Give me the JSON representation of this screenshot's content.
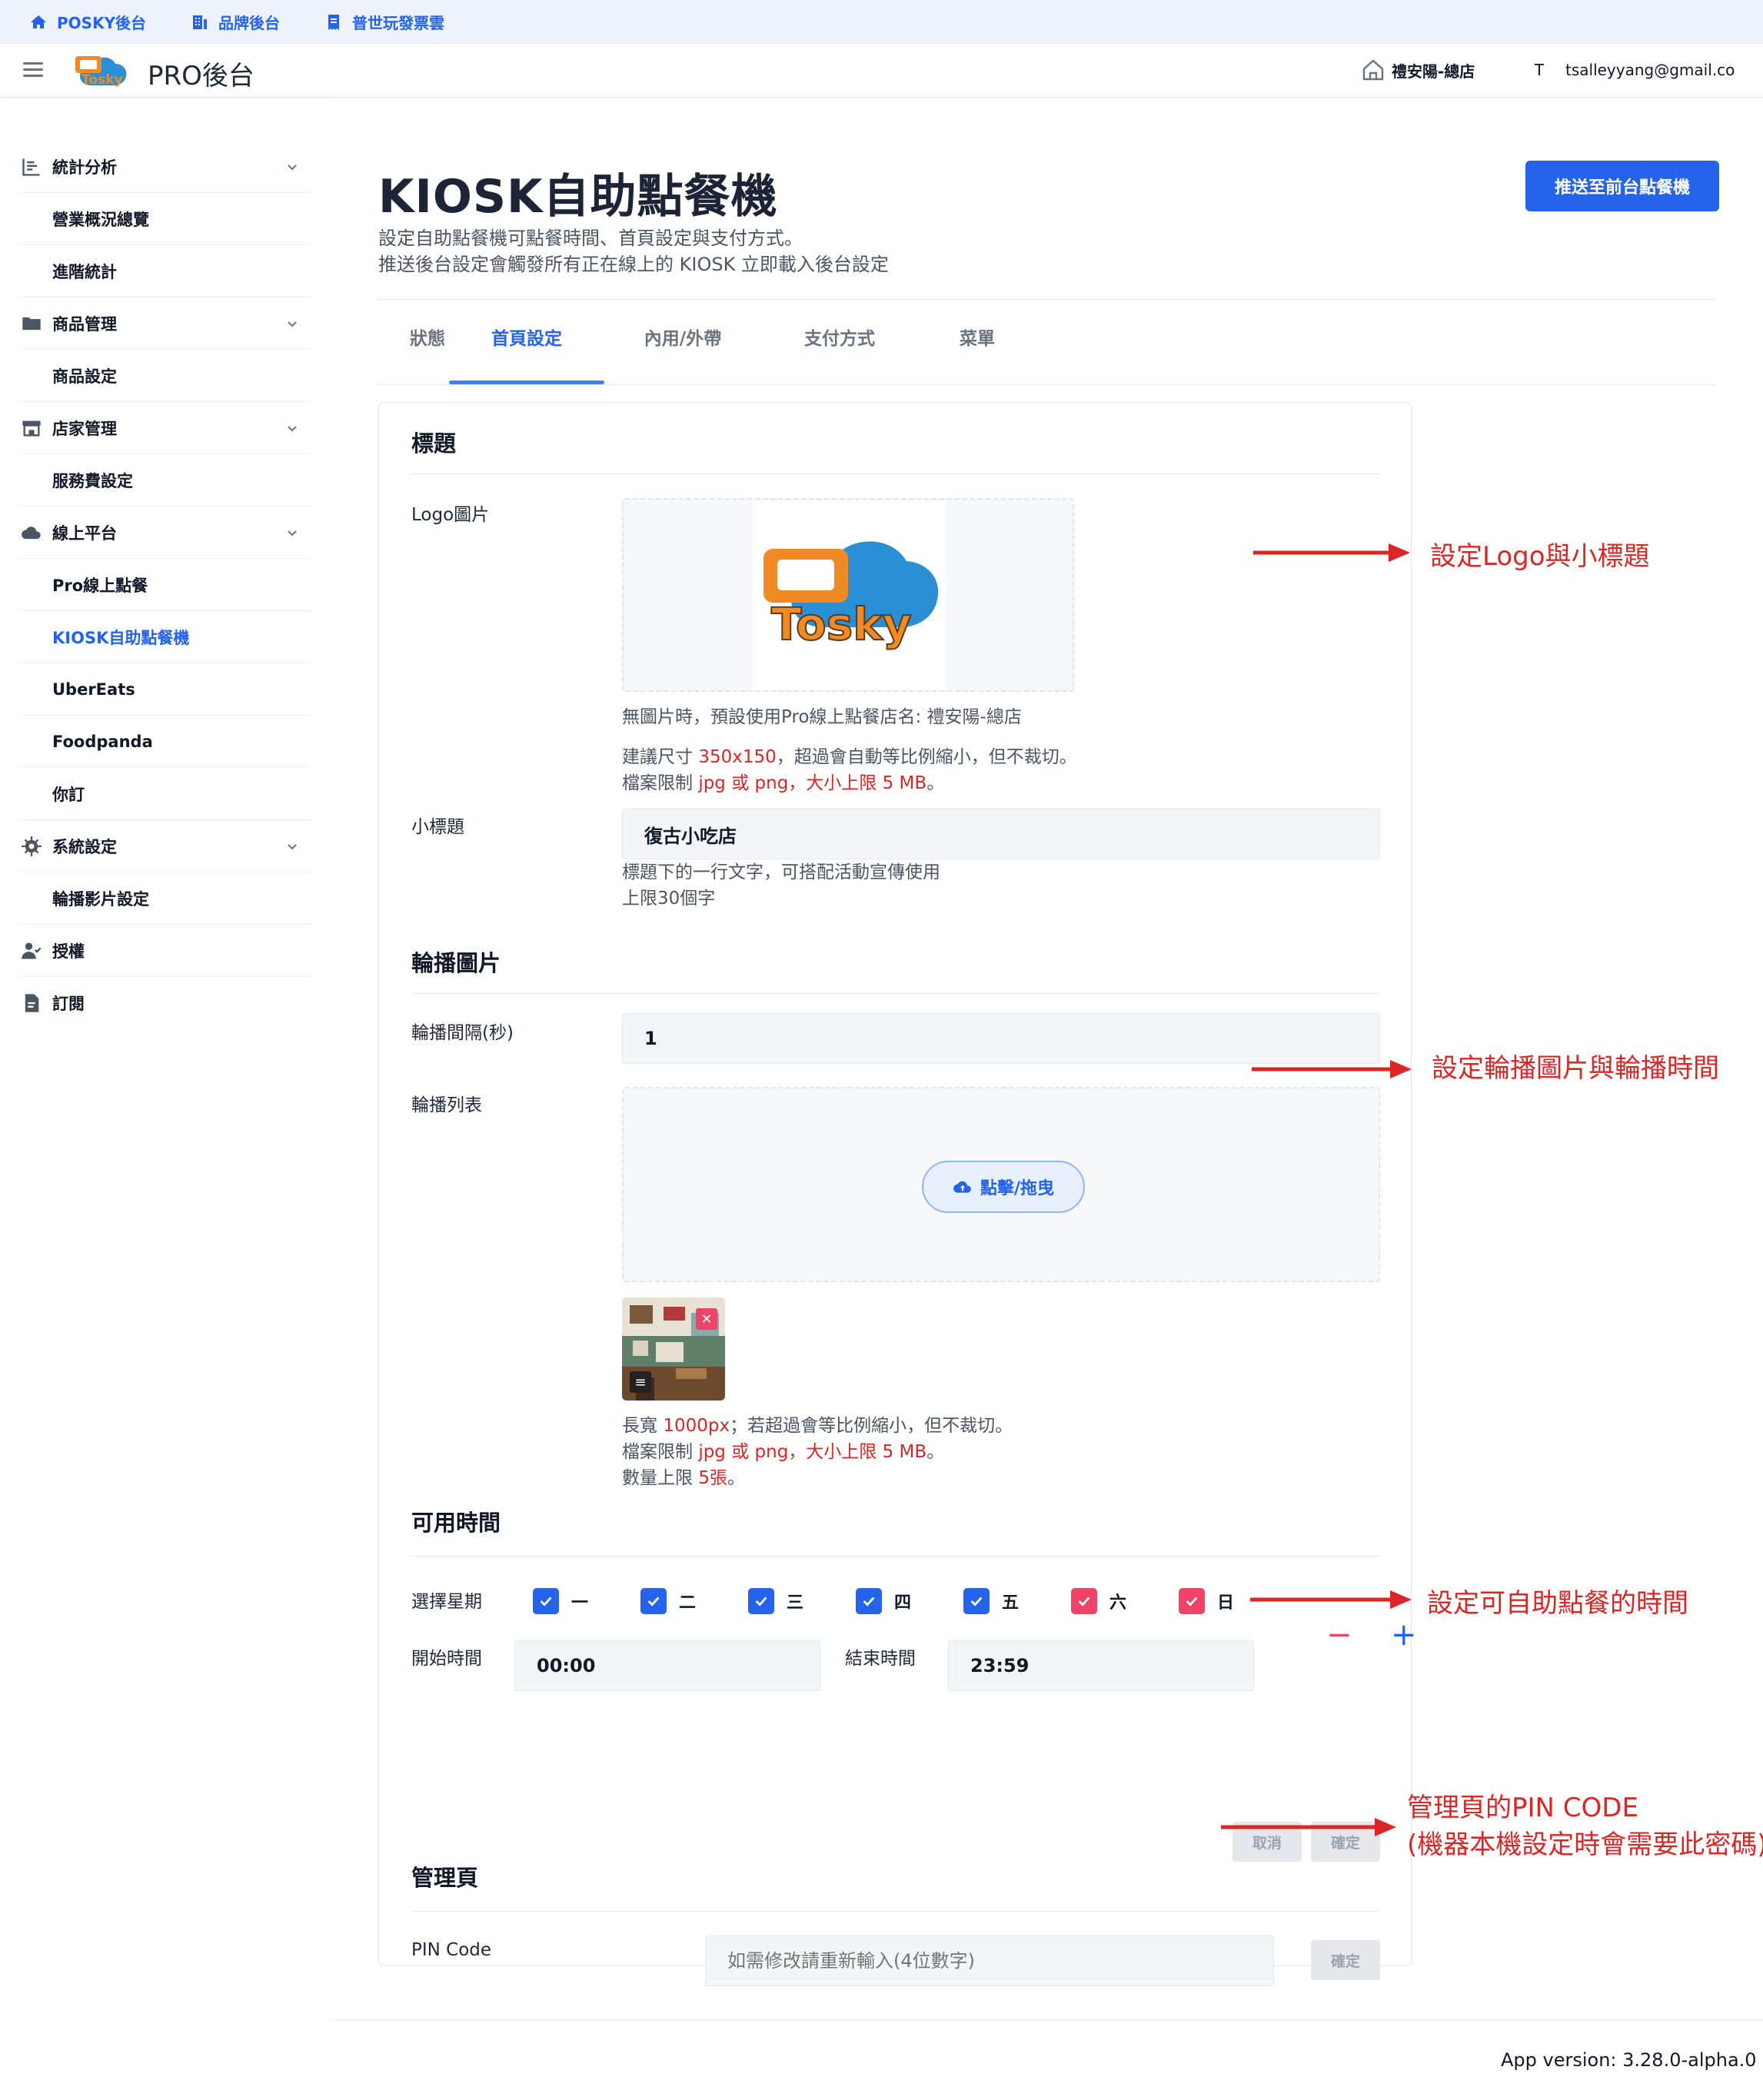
{
  "topbar": {
    "links": [
      {
        "label": "POSKY後台",
        "icon": "home-icon"
      },
      {
        "label": "品牌後台",
        "icon": "building-icon"
      },
      {
        "label": "普世玩發票雲",
        "icon": "receipt-icon"
      }
    ]
  },
  "header": {
    "title": "PRO後台",
    "store": "禮安陽-總店",
    "avatar_initial": "T",
    "email": "tsalleyyang@gmail.co"
  },
  "sidebar": {
    "items": [
      {
        "label": "統計分析",
        "icon": "chart-icon",
        "type": "group"
      },
      {
        "label": "營業概況總覽",
        "type": "sub"
      },
      {
        "label": "進階統計",
        "type": "sub"
      },
      {
        "label": "商品管理",
        "icon": "folder-icon",
        "type": "group"
      },
      {
        "label": "商品設定",
        "type": "sub"
      },
      {
        "label": "店家管理",
        "icon": "store-icon",
        "type": "group"
      },
      {
        "label": "服務費設定",
        "type": "sub"
      },
      {
        "label": "線上平台",
        "icon": "cloud-icon",
        "type": "group"
      },
      {
        "label": "Pro線上點餐",
        "type": "sub"
      },
      {
        "label": "KIOSK自助點餐機",
        "type": "sub",
        "active": true
      },
      {
        "label": "UberEats",
        "type": "sub"
      },
      {
        "label": "Foodpanda",
        "type": "sub"
      },
      {
        "label": "你訂",
        "type": "sub"
      },
      {
        "label": "系統設定",
        "icon": "gear-icon",
        "type": "group"
      },
      {
        "label": "輪播影片設定",
        "type": "sub"
      },
      {
        "label": "授權",
        "icon": "user-check-icon",
        "type": "single"
      },
      {
        "label": "訂閱",
        "icon": "document-icon",
        "type": "single"
      }
    ]
  },
  "page": {
    "title": "KIOSK自助點餐機",
    "desc_line1": "設定自助點餐機可點餐時間、首頁設定與支付方式。",
    "desc_line2": "推送後台設定會觸發所有正在線上的 KIOSK 立即載入後台設定",
    "push_button": "推送至前台點餐機"
  },
  "tabs": [
    "狀態",
    "首頁設定",
    "內用/外帶",
    "支付方式",
    "菜單"
  ],
  "active_tab": "首頁設定",
  "form": {
    "title_section": "標題",
    "logo_label": "Logo圖片",
    "logo_hint1": "無圖片時，預設使用Pro線上點餐店名: 禮安陽-總店",
    "logo_hint2_a": "建議尺寸 ",
    "logo_hint2_b": "350x150",
    "logo_hint2_c": "，超過會自動等比例縮小，但不裁切。",
    "logo_hint3_a": "檔案限制 ",
    "logo_hint3_b": "jpg 或 png，大小上限 5 MB",
    "logo_hint3_c": "。",
    "subtitle_label": "小標題",
    "subtitle_value": "復古小吃店",
    "subtitle_hint1": "標題下的一行文字，可搭配活動宣傳使用",
    "subtitle_hint2": "上限30個字",
    "carousel_section": "輪播圖片",
    "interval_label": "輪播間隔(秒)",
    "interval_value": "1",
    "list_label": "輪播列表",
    "upload_label": "點擊/拖曳",
    "carousel_hint1_a": "長寬 ",
    "carousel_hint1_b": "1000px",
    "carousel_hint1_c": "；若超過會等比例縮小，但不裁切。",
    "carousel_hint2_a": "檔案限制 ",
    "carousel_hint2_b": "jpg 或 png，大小上限 5 MB",
    "carousel_hint2_c": "。",
    "carousel_hint3_a": "數量上限 ",
    "carousel_hint3_b": "5張",
    "carousel_hint3_c": "。",
    "time_section": "可用時間",
    "weekday_label": "選擇星期",
    "days": [
      {
        "label": "一",
        "checked": true,
        "color": "#2563eb"
      },
      {
        "label": "二",
        "checked": true,
        "color": "#2563eb"
      },
      {
        "label": "三",
        "checked": true,
        "color": "#2563eb"
      },
      {
        "label": "四",
        "checked": true,
        "color": "#2563eb"
      },
      {
        "label": "五",
        "checked": true,
        "color": "#2563eb"
      },
      {
        "label": "六",
        "checked": true,
        "color": "#ef4467"
      },
      {
        "label": "日",
        "checked": true,
        "color": "#ef4467"
      }
    ],
    "start_label": "開始時間",
    "start_value": "00:00",
    "end_label": "結束時間",
    "end_value": "23:59",
    "minus": "−",
    "plus": "+",
    "cancel": "取消",
    "confirm": "確定",
    "admin_section": "管理頁",
    "pin_label": "PIN Code",
    "pin_placeholder": "如需修改請重新輸入(4位數字)",
    "pin_confirm": "確定"
  },
  "annotations": {
    "logo": "設定Logo與小標題",
    "carousel": "設定輪播圖片與輪播時間",
    "time": "設定可自助點餐的時間",
    "pin_line1": "管理頁的PIN CODE",
    "pin_line2": "(機器本機設定時會需要此密碼)"
  },
  "footer": {
    "version": "App version: 3.28.0-alpha.0"
  },
  "colors": {
    "primary": "#2563eb",
    "danger": "#dc2626",
    "weekend": "#ef4467"
  }
}
